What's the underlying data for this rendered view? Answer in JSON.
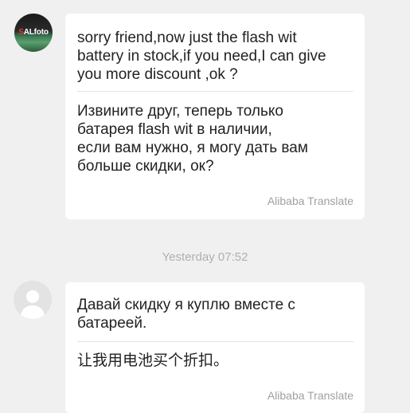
{
  "seller": {
    "logo_prefix": "S",
    "logo_rest": "ALfoto"
  },
  "messages": [
    {
      "original": "sorry friend,now just the flash wit\nbattery in stock,if you need,I can give\nyou more discount ,ok ?",
      "translation": "Извините друг, теперь только\nбатарея flash wit в наличии,\nесли вам нужно, я могу дать вам\nбольше скидки, ок?",
      "attribution": "Alibaba Translate"
    },
    {
      "original": "Давай скидку я куплю вместе с\nбатареей.",
      "translation": "让我用电池买个折扣。",
      "attribution": "Alibaba Translate"
    }
  ],
  "timestamp": "Yesterday 07:52"
}
